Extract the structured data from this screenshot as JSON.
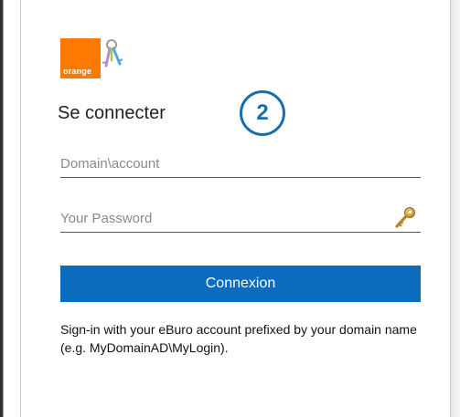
{
  "logo": {
    "text": "orange",
    "brand_color": "#ff7900",
    "companion_icon": "keys-icon"
  },
  "login": {
    "title": "Se connecter",
    "step_badge": "2",
    "step_badge_color": "#1a6fa8",
    "username": {
      "placeholder": "Domain\\account",
      "value": ""
    },
    "password": {
      "placeholder": "Your Password",
      "value": "",
      "icon": "key-icon"
    },
    "submit_label": "Connexion",
    "submit_color": "#0b6bbf",
    "help_text": "Sign-in with your eBuro account prefixed by your domain name (e.g. MyDomainAD\\MyLogin)."
  }
}
